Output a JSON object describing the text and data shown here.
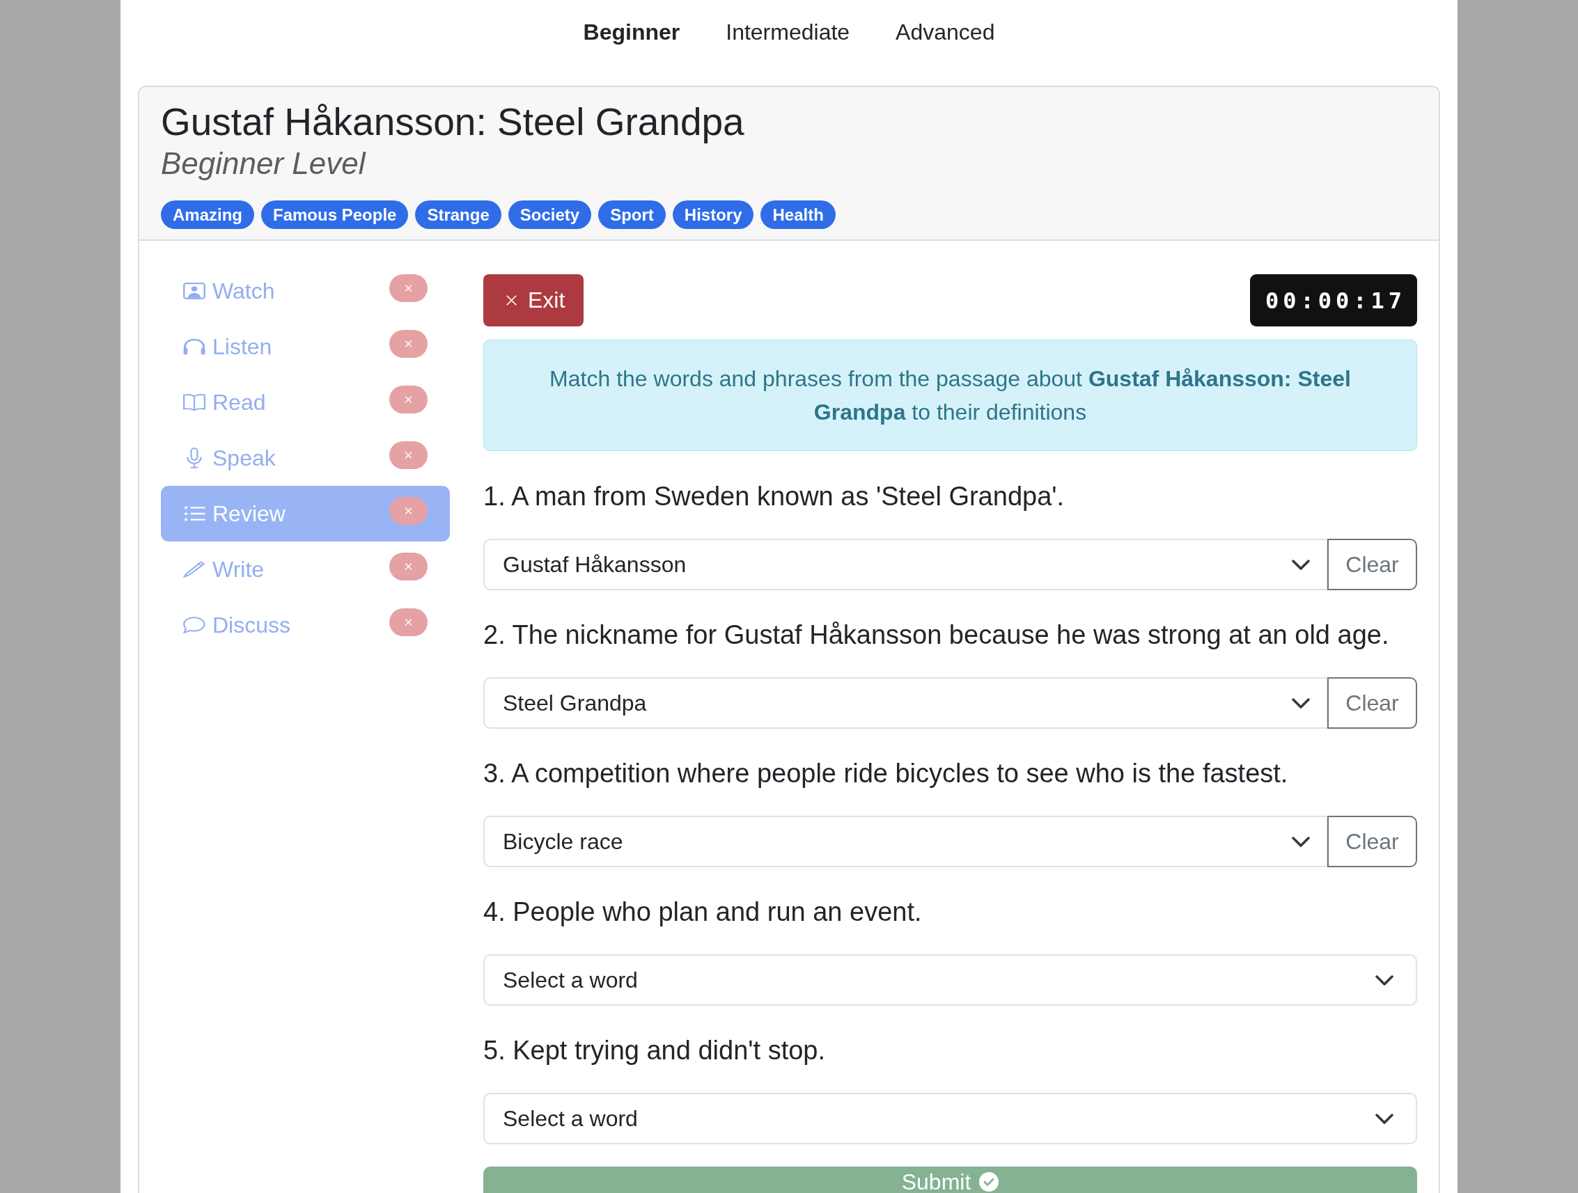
{
  "level_tabs": [
    {
      "label": "Beginner",
      "selected": true
    },
    {
      "label": "Intermediate",
      "selected": false
    },
    {
      "label": "Advanced",
      "selected": false
    }
  ],
  "lesson": {
    "title": "Gustaf Håkansson: Steel Grandpa",
    "subtitle": "Beginner Level",
    "tags": [
      "Amazing",
      "Famous People",
      "Strange",
      "Society",
      "Sport",
      "History",
      "Health"
    ]
  },
  "sidebar": {
    "items": [
      {
        "kind": "watch",
        "label": "Watch",
        "completed": false,
        "selected": false
      },
      {
        "kind": "listen",
        "label": "Listen",
        "completed": false,
        "selected": false
      },
      {
        "kind": "read",
        "label": "Read",
        "completed": false,
        "selected": false
      },
      {
        "kind": "speak",
        "label": "Speak",
        "completed": false,
        "selected": false
      },
      {
        "kind": "review",
        "label": "Review",
        "completed": false,
        "selected": true
      },
      {
        "kind": "write",
        "label": "Write",
        "completed": false,
        "selected": false
      },
      {
        "kind": "discuss",
        "label": "Discuss",
        "completed": false,
        "selected": false
      }
    ]
  },
  "toolbar": {
    "exit_label": "Exit",
    "timer": "00:00:17"
  },
  "instructions": "Match the words and phrases from the passage about **Gustaf Håkansson: Steel Grandpa** to their definitions",
  "questions": [
    {
      "text": "1. A man from Sweden known as 'Steel Grandpa'.",
      "value": "Gustaf Håkansson",
      "clear_label": "Clear"
    },
    {
      "text": "2. The nickname for Gustaf Håkansson because he was strong at an old age.",
      "value": "Steel Grandpa",
      "clear_label": "Clear"
    },
    {
      "text": "3. A competition where people ride bicycles to see who is the fastest.",
      "value": "Bicycle race",
      "clear_label": "Clear"
    },
    {
      "text": "4. People who plan and run an event.",
      "placeholder": "Select a word"
    },
    {
      "text": "5. Kept trying and didn't stop.",
      "placeholder": "Select a word"
    }
  ],
  "submit": {
    "label": "Submit"
  }
}
